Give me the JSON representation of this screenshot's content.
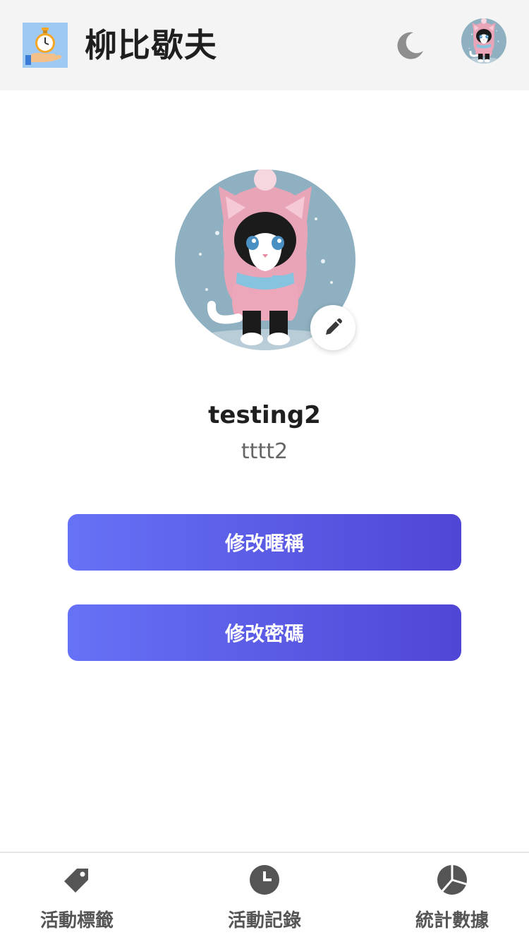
{
  "header": {
    "title": "柳比歇夫",
    "logo_icon": "stopwatch-in-hand-icon",
    "theme_icon": "moon-icon",
    "avatar_icon": "cat-avatar-icon"
  },
  "profile": {
    "avatar_icon": "cat-avatar-icon",
    "edit_icon": "pencil-icon",
    "display_name": "testing2",
    "username": "tttt2"
  },
  "actions": {
    "change_nickname_label": "修改暱稱",
    "change_password_label": "修改密碼"
  },
  "bottom_nav": {
    "items": [
      {
        "label": "活動標籤",
        "icon": "tag-icon"
      },
      {
        "label": "活動記錄",
        "icon": "clock-icon"
      },
      {
        "label": "統計數據",
        "icon": "pie-chart-icon"
      }
    ]
  },
  "colors": {
    "header_bg": "#f4f4f4",
    "button_gradient_start": "#6672f6",
    "button_gradient_end": "#5046d6",
    "nav_icon": "#555555",
    "avatar_bg": "#8fb0c0"
  }
}
